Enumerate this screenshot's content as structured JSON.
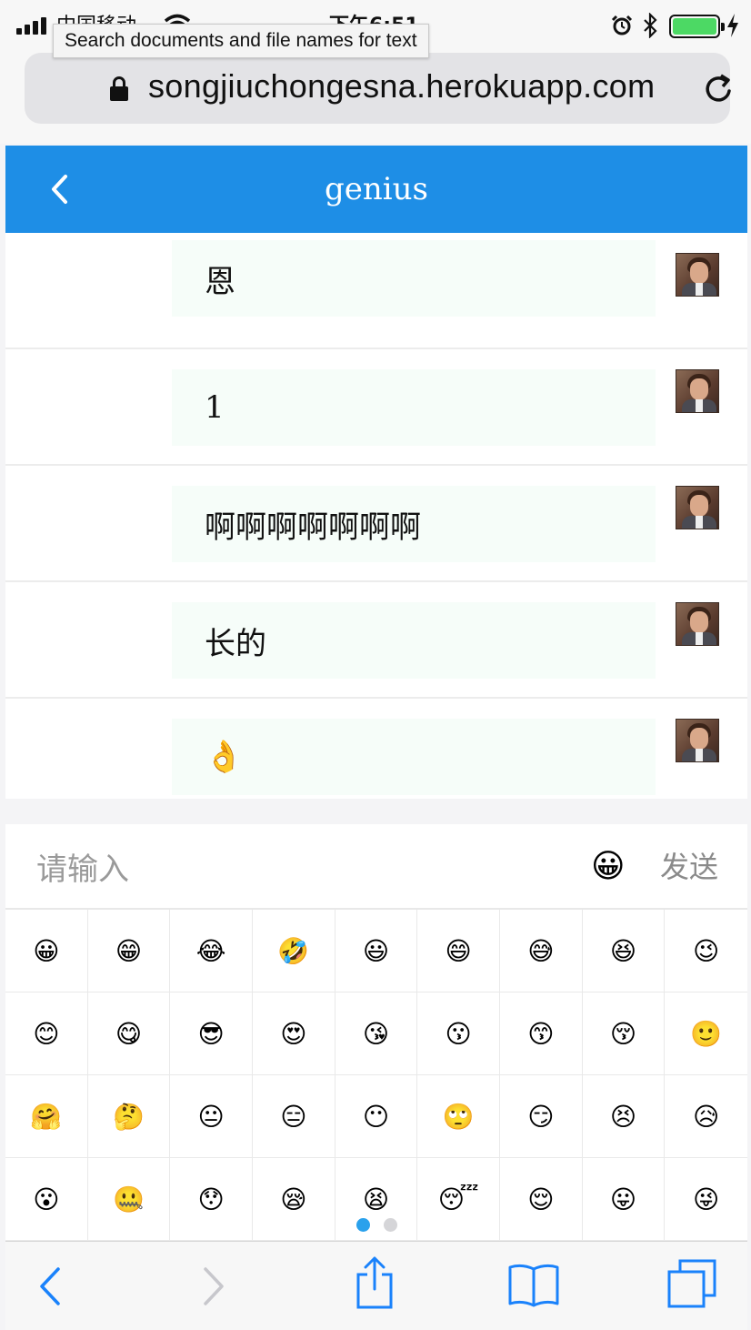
{
  "status_bar": {
    "carrier": "中国移动",
    "time": "下午6:51"
  },
  "tooltip": "Search documents and file names for text",
  "browser": {
    "url": "songjiuchongesna.herokuapp.com"
  },
  "header": {
    "title": "genius"
  },
  "messages": [
    {
      "text": "恩"
    },
    {
      "text": "1"
    },
    {
      "text": "啊啊啊啊啊啊啊"
    },
    {
      "text": "长的"
    },
    {
      "text": "👌"
    }
  ],
  "input": {
    "placeholder": "请输入",
    "emoji_button": "😀",
    "send_label": "发送"
  },
  "emoji_grid": [
    "😀",
    "😁",
    "😂",
    "🤣",
    "😃",
    "😄",
    "😅",
    "😆",
    "😉",
    "😊",
    "😋",
    "😎",
    "😍",
    "😘",
    "😗",
    "😙",
    "😚",
    "🙂",
    "🤗",
    "🤔",
    "😐",
    "😑",
    "😶",
    "🙄",
    "😏",
    "😣",
    "😥",
    "😮",
    "🤐",
    "😯",
    "😪",
    "😫",
    "😴",
    "😌",
    "😛",
    "😜"
  ],
  "pager": {
    "current_page": 1,
    "page_count": 2
  },
  "colors": {
    "header": "#1e8ee6",
    "bubble": "#f6fdf9",
    "toolbar_active": "#1a82fb",
    "toolbar_disabled": "#c7c7cc",
    "pager_active": "#2aa1ec",
    "pager_inactive": "#d5d5d8"
  },
  "toolbar": {
    "icons": [
      "back-icon",
      "forward-icon",
      "share-icon",
      "bookmarks-icon",
      "tabs-icon"
    ]
  }
}
